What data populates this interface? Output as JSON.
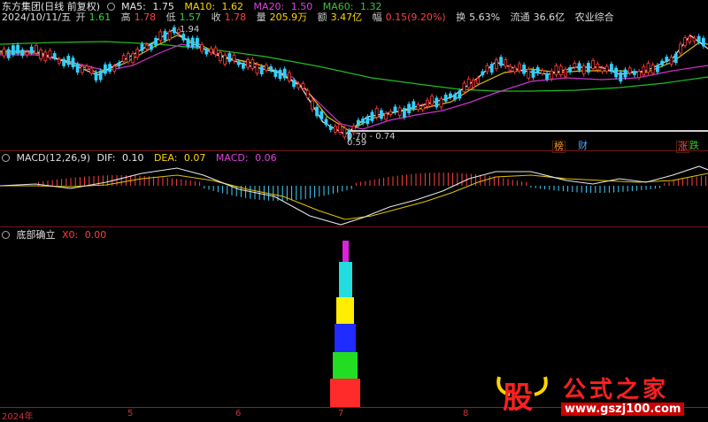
{
  "main": {
    "title": "东方集团(日线 前复权)",
    "ma": [
      {
        "label": "MA5:",
        "value": "1.75",
        "color": "#e6e6e6"
      },
      {
        "label": "MA10:",
        "value": "1.62",
        "color": "#ffd400"
      },
      {
        "label": "MA20:",
        "value": "1.50",
        "color": "#e040e0"
      },
      {
        "label": "MA60:",
        "value": "1.32",
        "color": "#40c040"
      }
    ],
    "quote": {
      "date": "2024/10/11/五",
      "open_label": "开",
      "open": "1.61",
      "high_label": "高",
      "high": "1.78",
      "low_label": "低",
      "low": "1.57",
      "close_label": "收",
      "close": "1.78",
      "vol_label": "量",
      "vol": "205.9万",
      "amt_label": "额",
      "amt": "3.47亿",
      "chg_label": "幅",
      "chg": "0.15(9.20%)",
      "turn_label": "换",
      "turn": "5.63%",
      "float_label": "流通",
      "float": "36.6亿",
      "sector": "农业综合"
    },
    "annotations": {
      "high_mark": "1.94",
      "low_mark": "0.59",
      "range_mark": "0.70 - 0.74"
    },
    "event_tags": [
      {
        "text": "榜",
        "color": "#ff9933"
      },
      {
        "text": "财",
        "color": "#4aa3ff"
      },
      {
        "text": "涨",
        "color": "#ff5050"
      },
      {
        "text": "跌",
        "color": "#33cc33"
      }
    ]
  },
  "macd": {
    "title": "MACD(12,26,9)",
    "dif_label": "DIF:",
    "dif": "0.10",
    "dea_label": "DEA:",
    "dea": "0.07",
    "macd_label": "MACD:",
    "macd": "0.06"
  },
  "indicator": {
    "title": "底部确立",
    "x0_label": "X0:",
    "x0": "0.00",
    "bar_colors": [
      "#ff2a2a",
      "#22dd22",
      "#1f2bff",
      "#ffee00",
      "#22dddd",
      "#dd22dd"
    ]
  },
  "xaxis": [
    "2024年",
    "5",
    "6",
    "7",
    "8"
  ],
  "watermark": {
    "char": "股",
    "brand": "公式之家",
    "url": "www.gszj100.com"
  },
  "colors": {
    "up": "#ff3b3b",
    "down": "#30d0ff",
    "grid": "#7a1515",
    "text": "#cccccc"
  }
}
